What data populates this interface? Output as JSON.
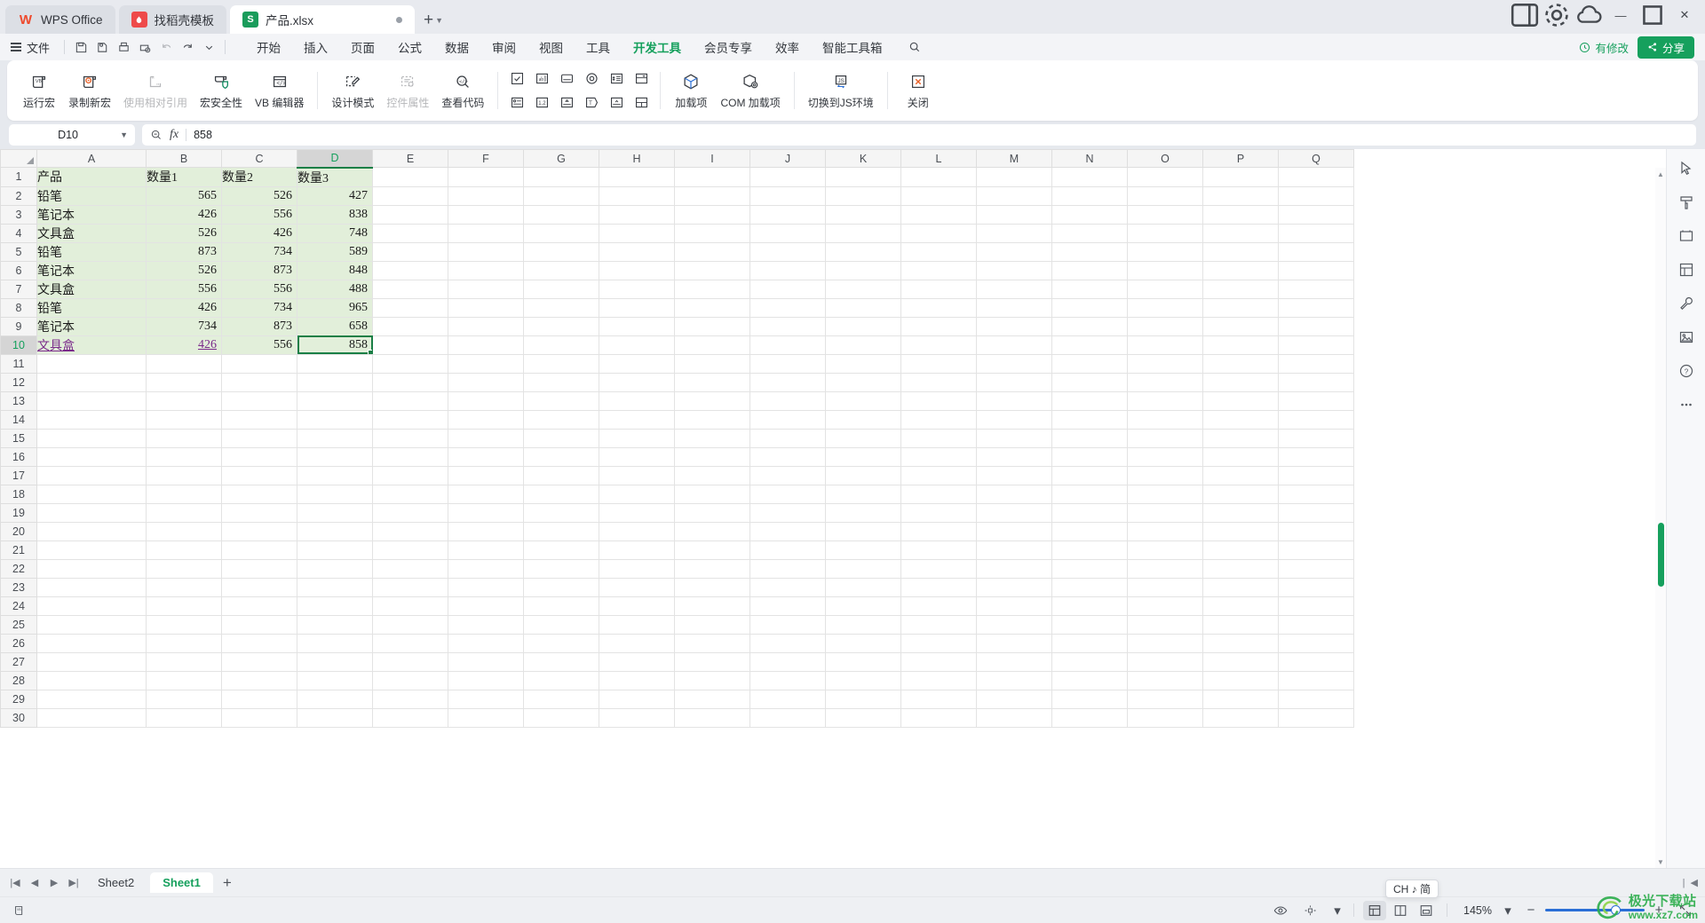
{
  "window": {
    "tabs": [
      {
        "label": "WPS Office",
        "icon": "wps-logo-icon",
        "type": "home"
      },
      {
        "label": "找稻壳模板",
        "icon": "template-icon",
        "type": "doc"
      },
      {
        "label": "产品.xlsx",
        "icon": "spreadsheet-icon",
        "type": "doc",
        "active": true
      }
    ],
    "new_tab_label": "+",
    "controls": {
      "minimize": "—",
      "maximize": "▢",
      "close": "✕"
    }
  },
  "menu": {
    "file_label": "文件",
    "quick_access": [
      "save-icon",
      "save-as-icon",
      "print-icon",
      "print-preview-icon",
      "undo-icon",
      "redo-icon",
      "customize-chevron-icon"
    ],
    "tabs": [
      {
        "label": "开始"
      },
      {
        "label": "插入"
      },
      {
        "label": "页面"
      },
      {
        "label": "公式"
      },
      {
        "label": "数据"
      },
      {
        "label": "审阅"
      },
      {
        "label": "视图"
      },
      {
        "label": "工具"
      },
      {
        "label": "开发工具",
        "active": true
      },
      {
        "label": "会员专享"
      },
      {
        "label": "效率"
      },
      {
        "label": "智能工具箱"
      }
    ],
    "search_icon": "search-icon",
    "saved_label": "有修改",
    "share_label": "分享"
  },
  "ribbon": {
    "groups": [
      {
        "buttons": [
          {
            "label": "运行宏",
            "icon": "run-macro-icon",
            "disabled": false
          },
          {
            "label": "录制新宏",
            "icon": "record-macro-icon",
            "disabled": false
          },
          {
            "label": "使用相对引用",
            "icon": "relative-reference-icon",
            "disabled": true
          },
          {
            "label": "宏安全性",
            "icon": "macro-security-icon",
            "disabled": false
          },
          {
            "label": "VB 编辑器",
            "icon": "vb-editor-icon",
            "disabled": false
          }
        ]
      },
      {
        "buttons": [
          {
            "label": "设计模式",
            "icon": "design-mode-icon",
            "disabled": false
          },
          {
            "label": "控件属性",
            "icon": "control-properties-icon",
            "disabled": true
          },
          {
            "label": "查看代码",
            "icon": "view-code-icon",
            "disabled": false
          }
        ]
      },
      {
        "controls_grid": [
          "checkbox-control-icon",
          "textbox-control-icon",
          "button-control-icon",
          "option-control-icon",
          "spinner-control-icon",
          "combobox-control-icon",
          "listbox-control-icon",
          "scrollbar-control-icon",
          "groupbox-control-icon",
          "label-control-icon",
          "togglebutton-control-icon",
          "frame-control-icon"
        ]
      },
      {
        "buttons": [
          {
            "label": "加载项",
            "icon": "addins-icon",
            "disabled": false
          },
          {
            "label": "COM 加载项",
            "icon": "com-addins-icon",
            "disabled": false
          }
        ]
      },
      {
        "buttons": [
          {
            "label": "切换到JS环境",
            "icon": "js-environment-icon",
            "disabled": false
          }
        ]
      },
      {
        "buttons": [
          {
            "label": "关闭",
            "icon": "close-designer-icon",
            "disabled": false
          }
        ]
      }
    ]
  },
  "formula_bar": {
    "name_box_value": "D10",
    "name_box_chevron": "chevron-down-icon",
    "zoom_icon": "zoom-formula-icon",
    "fx_label": "fx",
    "formula_value": "858"
  },
  "sheet": {
    "column_headers": [
      "A",
      "B",
      "C",
      "D",
      "E",
      "F",
      "G",
      "H",
      "I",
      "J",
      "K",
      "L",
      "M",
      "N",
      "O",
      "P",
      "Q"
    ],
    "selected_column": "D",
    "selected_row": 10,
    "active_cell": "D10",
    "row_count": 30,
    "table_headers": [
      "产品",
      "数量1",
      "数量2",
      "数量3"
    ],
    "rows": [
      {
        "product": "铅笔",
        "q1": "565",
        "q2": "526",
        "q3": "427"
      },
      {
        "product": "笔记本",
        "q1": "426",
        "q2": "556",
        "q3": "838"
      },
      {
        "product": "文具盒",
        "q1": "526",
        "q2": "426",
        "q3": "748"
      },
      {
        "product": "铅笔",
        "q1": "873",
        "q2": "734",
        "q3": "589"
      },
      {
        "product": "笔记本",
        "q1": "526",
        "q2": "873",
        "q3": "848"
      },
      {
        "product": "文具盒",
        "q1": "556",
        "q2": "556",
        "q3": "488"
      },
      {
        "product": "铅笔",
        "q1": "426",
        "q2": "734",
        "q3": "965"
      },
      {
        "product": "笔记本",
        "q1": "734",
        "q2": "873",
        "q3": "658"
      },
      {
        "product": "文具盒",
        "q1": "426",
        "q2": "556",
        "q3": "858"
      }
    ]
  },
  "right_tools": [
    "cursor-select-icon",
    "format-brush-icon",
    "frame-tool-icon",
    "pivot-tool-icon",
    "tools-wrench-icon",
    "image-tool-icon",
    "help-question-icon",
    "more-options-icon"
  ],
  "sheet_bar": {
    "nav": [
      "first-sheet-icon",
      "prev-sheet-icon",
      "next-sheet-icon",
      "last-sheet-icon"
    ],
    "sheets": [
      {
        "label": "Sheet2",
        "active": false
      },
      {
        "label": "Sheet1",
        "active": true
      }
    ],
    "add_label": "+"
  },
  "status_bar": {
    "ime_label": "CH ♪ 简",
    "eye_icon": "eye-icon",
    "layout_icon": "layout-icon",
    "views": [
      "normal-view-icon",
      "page-layout-icon",
      "page-break-icon"
    ],
    "active_view": "normal-view-icon",
    "zoom_label": "145%",
    "zoom_chevron": "chevron-down-icon",
    "zoom_out": "−",
    "zoom_in": "+",
    "fullscreen_icon": "fullscreen-icon"
  },
  "watermark": {
    "line1": "极光下载站",
    "line2": "www.xz7.com"
  },
  "colors": {
    "accent_green": "#16a05d",
    "selection_green": "#1a7f46",
    "fill_green": "#e2efda",
    "slider_blue": "#2a6fd6"
  }
}
